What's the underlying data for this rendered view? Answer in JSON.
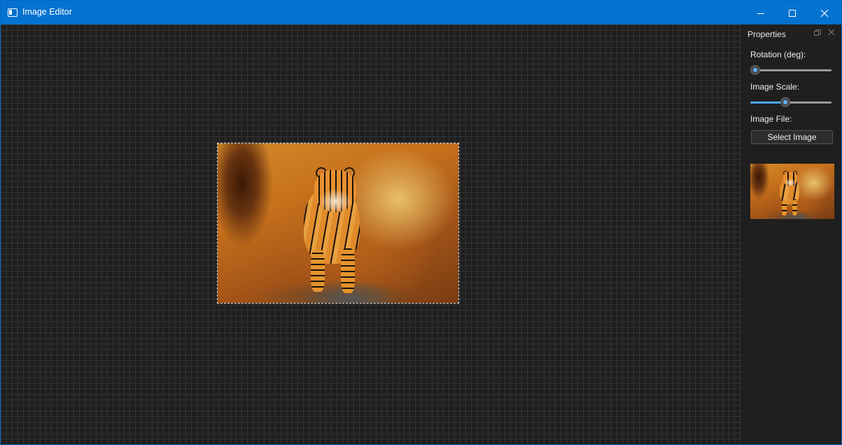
{
  "window": {
    "title": "Image Editor",
    "icon": "app-window-icon",
    "controls": {
      "minimize": "minimize-icon",
      "maximize": "maximize-icon",
      "close": "close-icon"
    },
    "accent": "#0372d0"
  },
  "canvas": {
    "background": "#1f1f1f",
    "grid_color": "#333333",
    "image": {
      "subject": "tiger",
      "selected": true
    }
  },
  "properties": {
    "title": "Properties",
    "header_icons": [
      "float-icon",
      "close-panel-icon"
    ],
    "rotation": {
      "label": "Rotation (deg):",
      "value_fraction": 0.0
    },
    "scale": {
      "label": "Image Scale:",
      "value_fraction": 0.42
    },
    "file": {
      "label": "Image File:",
      "button": "Select Image"
    },
    "preview": {
      "subject": "tiger"
    }
  }
}
